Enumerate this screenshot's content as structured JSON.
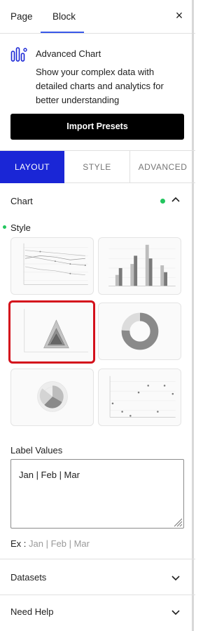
{
  "top_tabs": {
    "page": "Page",
    "block": "Block"
  },
  "close_symbol": "×",
  "block": {
    "title": "Advanced Chart",
    "description": "Show your complex data with detailed charts and analytics for better understanding",
    "icon": "chart-icon"
  },
  "import_button": "Import Presets",
  "sub_tabs": {
    "layout": "LAYOUT",
    "style": "STYLE",
    "advanced": "ADVANCED"
  },
  "chart_section": {
    "title": "Chart",
    "status_color": "#22c55e"
  },
  "style_section": {
    "title": "Style"
  },
  "presets": [
    "line-chart-preset",
    "bar-chart-preset",
    "radar-chart-preset",
    "doughnut-chart-preset",
    "polar-area-chart-preset",
    "scatter-chart-preset"
  ],
  "selected_preset": "radar-chart-preset",
  "label_values": {
    "label": "Label Values",
    "value": "Jan | Feb | Mar",
    "example_prefix": "Ex : ",
    "example_value": "Jan | Feb | Mar"
  },
  "accordions": {
    "datasets": "Datasets",
    "need_help": "Need Help"
  },
  "colors": {
    "accent": "#1a26d6",
    "selected_border": "#d4111c",
    "tab_underline": "#3858e9"
  }
}
